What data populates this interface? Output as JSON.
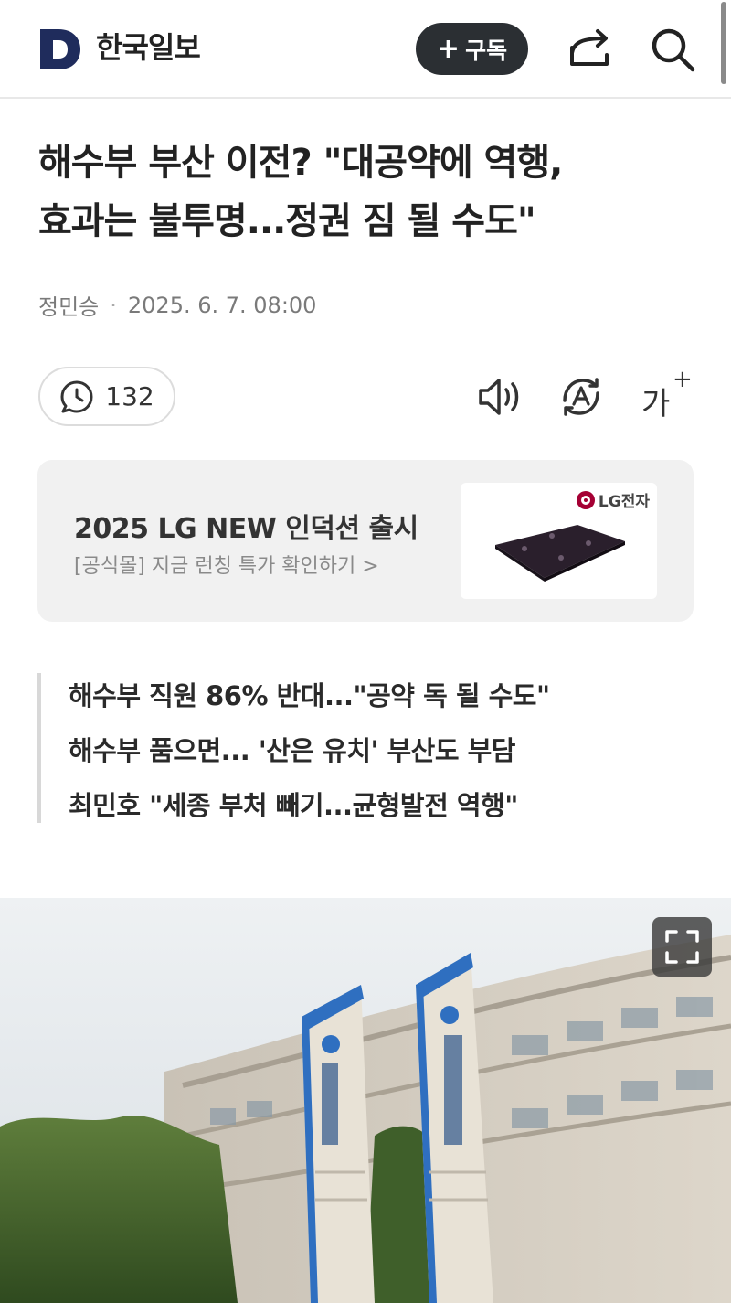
{
  "header": {
    "logo_text": "한국일보",
    "subscribe_label": "구독",
    "subscribe_plus": "+"
  },
  "article": {
    "headline_line1": "해수부 부산 이전? \"대공약에 역행,",
    "headline_line2": "효과는 불투명...정권 짐 될 수도\"",
    "author": "정민승",
    "date": "2025. 6. 7. 08:00"
  },
  "toolbar": {
    "comment_count": "132",
    "fontsize_label": "가",
    "fontsize_plus": "+"
  },
  "ad": {
    "title": "2025 LG NEW 인덕션 출시",
    "subtitle": "[공식몰] 지금 런칭 특가 확인하기 >",
    "brand": "LG전자",
    "accent_color": "#a50034"
  },
  "related": [
    "해수부 직원 86% 반대...\"공약 독 될 수도\"",
    "해수부 품으면... '산은 유치' 부산도 부담",
    "최민호 \"세종 부처 빼기...균형발전 역행\""
  ],
  "icons": [
    "logo-d-icon",
    "share-icon",
    "search-icon",
    "comment-icon",
    "speaker-icon",
    "translate-icon",
    "font-size-icon",
    "expand-icon"
  ]
}
